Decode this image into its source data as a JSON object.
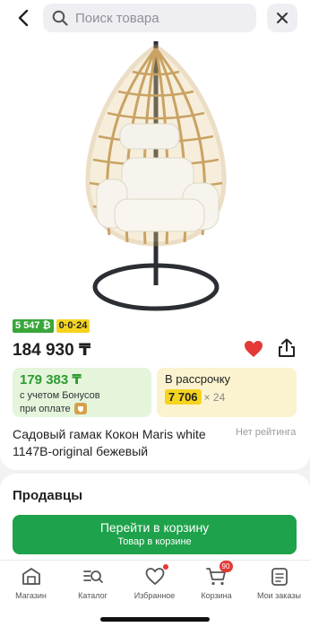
{
  "header": {
    "back_icon": "chevron-left-icon",
    "search_placeholder": "Поиск товара",
    "close_icon": "close-icon"
  },
  "product": {
    "image": "hanging-egg-chair-photo",
    "badges": {
      "bonus": "5 547 ₿",
      "installment": "0·0·24"
    },
    "price": "184 930 ₸",
    "bonus_offer": {
      "price": "179 383 ₸",
      "line1": "с учетом Бонусов",
      "line2": "при оплате"
    },
    "installment": {
      "title": "В рассрочку",
      "amount": "7 706",
      "multiplier": "× 24"
    },
    "title": "Садовый гамак Кокон Maris white 1147B-original бежевый",
    "rating_text": "Нет рейтинга",
    "favorite_color": "#e53935"
  },
  "sellers": {
    "title": "Продавцы",
    "cart_button": {
      "label": "Перейти в корзину",
      "sublabel": "Товар в корзине"
    }
  },
  "nav": {
    "items": [
      {
        "label": "Магазин",
        "icon": "store-icon"
      },
      {
        "label": "Каталог",
        "icon": "catalog-search-icon"
      },
      {
        "label": "Избранное",
        "icon": "heart-icon"
      },
      {
        "label": "Корзина",
        "icon": "cart-icon",
        "badge": "90"
      },
      {
        "label": "Мои заказы",
        "icon": "orders-icon"
      }
    ]
  },
  "colors": {
    "accent_green": "#1ea24b",
    "bonus_green": "#2f9a2f",
    "kaspi_red": "#e53935"
  }
}
